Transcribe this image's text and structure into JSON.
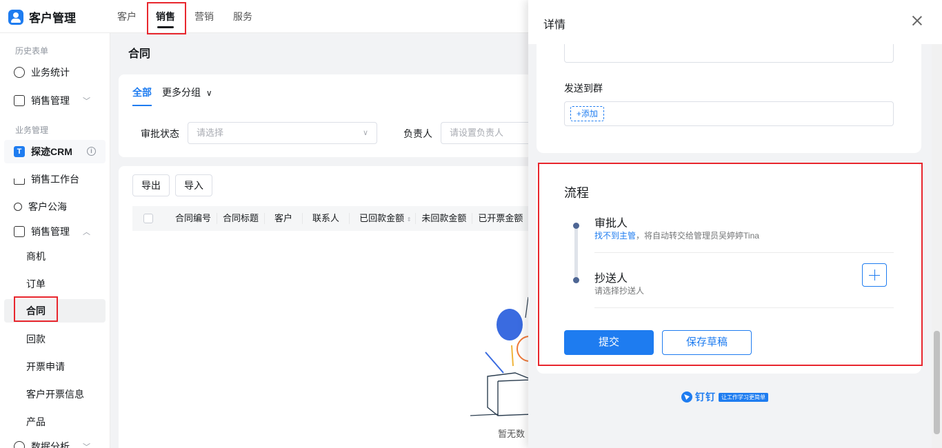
{
  "app": {
    "title": "客户管理"
  },
  "topnav": {
    "tabs": [
      "客户",
      "销售",
      "营销",
      "服务"
    ]
  },
  "sidebar": {
    "group_history": "历史表单",
    "item_stats": "业务统计",
    "item_sales_mgmt_1": "销售管理",
    "group_business": "业务管理",
    "item_crm": "探迹CRM",
    "item_workbench": "销售工作台",
    "item_public_pool": "客户公海",
    "item_sales_mgmt_2": "销售管理",
    "sub_items": [
      "商机",
      "订单",
      "合同",
      "回款",
      "开票申请",
      "客户开票信息",
      "产品"
    ],
    "item_data_analysis": "数据分析"
  },
  "main": {
    "title": "合同",
    "filter_tab_all": "全部",
    "filter_tab_more": "更多分组",
    "approval_label": "审批状态",
    "approval_placeholder": "请选择",
    "owner_label": "负责人",
    "owner_placeholder": "请设置负责人",
    "export_label": "导出",
    "import_label": "导入",
    "columns": [
      "合同编号",
      "合同标题",
      "客户",
      "联系人",
      "已回款金额",
      "未回款金额",
      "已开票金额"
    ],
    "empty_text": "暂无数"
  },
  "detail": {
    "title": "详情",
    "send_to_group_label": "发送到群",
    "add_chip": "+添加",
    "flow_title": "流程",
    "approver_label": "审批人",
    "approver_link": "找不到主管",
    "approver_desc": "，将自动转交给管理员吴婷婷Tina",
    "cc_label": "抄送人",
    "cc_desc": "请选择抄送人",
    "submit_label": "提交",
    "save_draft_label": "保存草稿",
    "brand_name": "钉钉",
    "brand_slogan": "让工作学习更简单"
  },
  "colors": {
    "accent": "#1e7cf0",
    "highlight": "#e8262d"
  }
}
